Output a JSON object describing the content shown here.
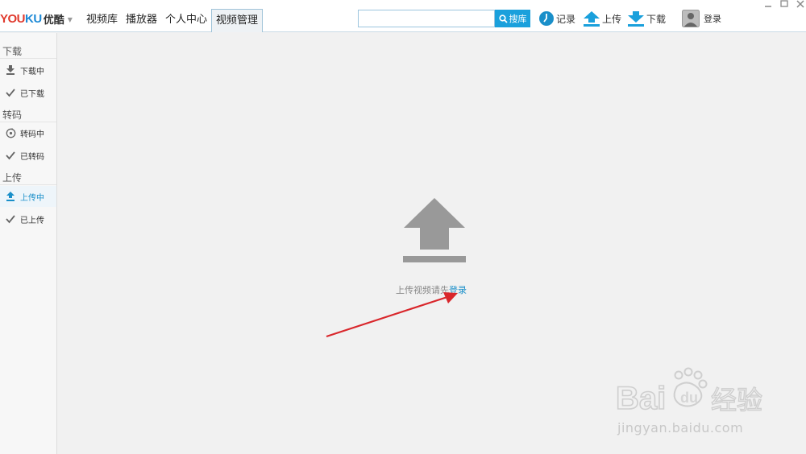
{
  "app": {
    "logo_text_y": "YOU",
    "logo_text_k": "KU",
    "logo_cn": "优酷"
  },
  "nav": {
    "tabs": [
      {
        "label": "视频库"
      },
      {
        "label": "播放器"
      },
      {
        "label": "个人中心"
      },
      {
        "label": "视频管理",
        "active": true
      }
    ]
  },
  "search": {
    "value": "",
    "placeholder": "",
    "button_label": "搜库"
  },
  "toolbar": {
    "history_label": "记录",
    "upload_label": "上传",
    "download_label": "下载",
    "login_label": "登录"
  },
  "sidebar": {
    "sections": [
      {
        "title": "下载",
        "items": [
          {
            "label": "下载中",
            "icon": "download-icon"
          },
          {
            "label": "已下载",
            "icon": "check-icon"
          }
        ]
      },
      {
        "title": "转码",
        "items": [
          {
            "label": "转码中",
            "icon": "transcode-icon"
          },
          {
            "label": "已转码",
            "icon": "check-icon"
          }
        ]
      },
      {
        "title": "上传",
        "items": [
          {
            "label": "上传中",
            "icon": "upload-icon",
            "active": true
          },
          {
            "label": "已上传",
            "icon": "check-icon"
          }
        ]
      }
    ]
  },
  "main": {
    "message_prefix": "上传视频请先",
    "login_link": "登录"
  },
  "watermark": {
    "brand": "Bai du 经验",
    "url": "jingyan.baidu.com"
  },
  "colors": {
    "accent": "#1aa0dc",
    "link": "#1a8fc9",
    "annotation_arrow": "#d9262b",
    "logo_red": "#e03a2d",
    "logo_blue": "#1e8ad6"
  }
}
